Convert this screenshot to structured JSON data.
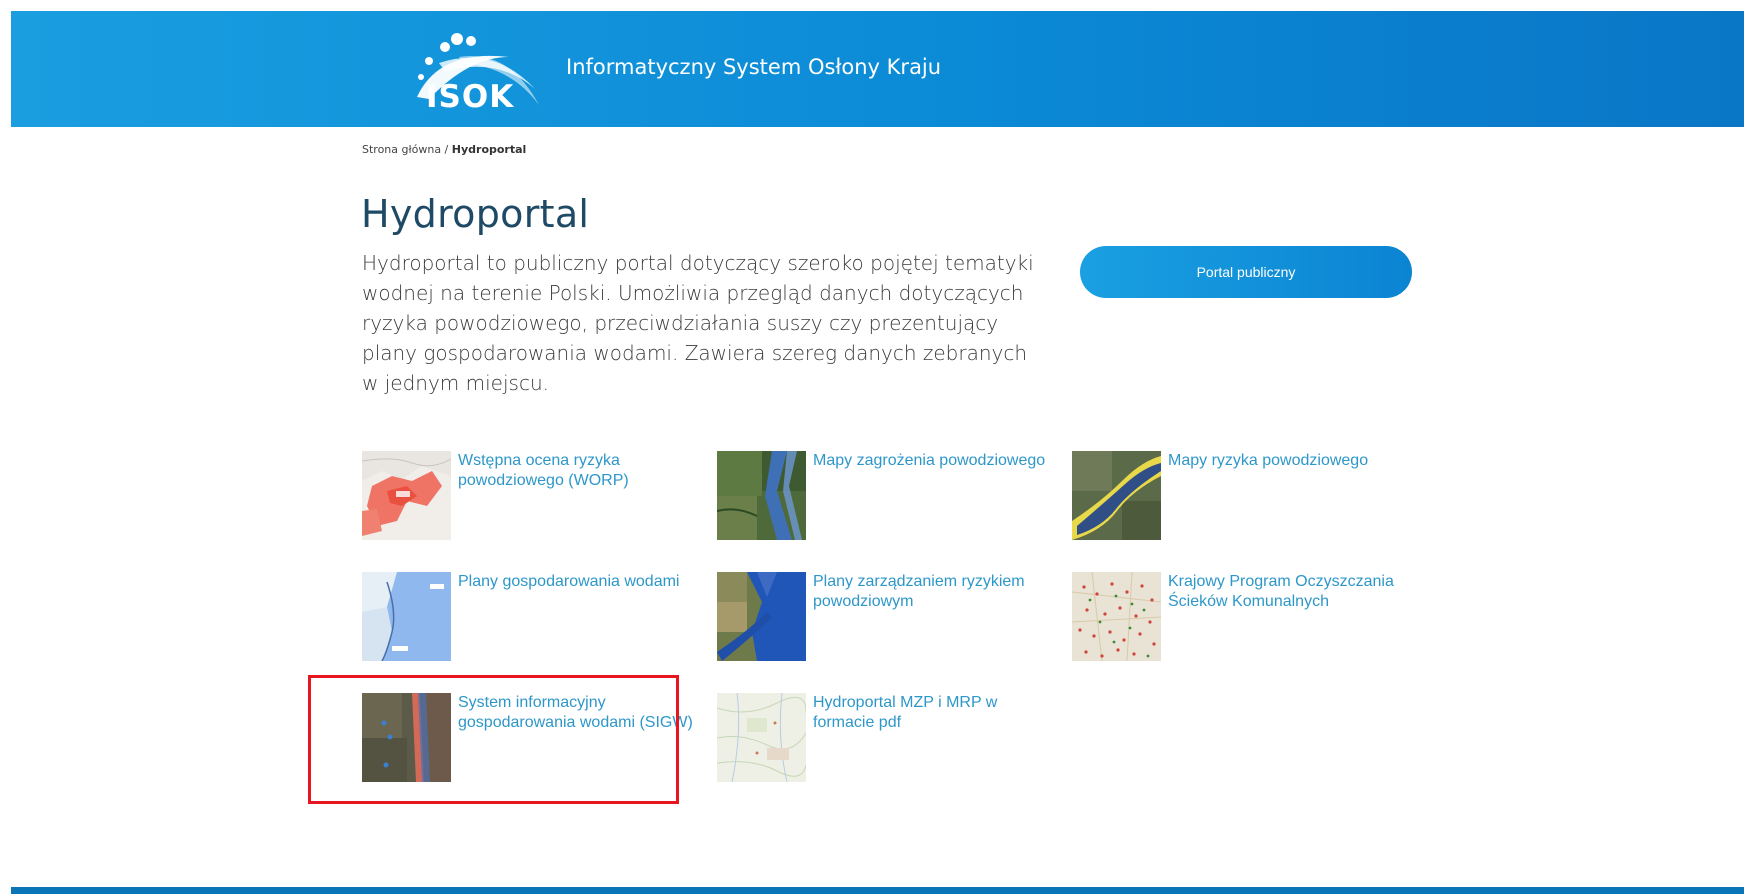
{
  "header": {
    "logo_text": "ISOK",
    "site_title": "Informatyczny System Osłony Kraju"
  },
  "breadcrumb": {
    "home": "Strona główna",
    "separator": " / ",
    "current": "Hydroportal"
  },
  "main": {
    "title": "Hydroportal",
    "description": "Hydroportal to publiczny portal dotyczący szeroko pojętej tematyki wodnej na terenie Polski. Umożliwia przegląd danych dotyczących ryzyka powodziowego, przeciwdziałania suszy czy prezentujący plany gospodarowania wodami. Zawiera szereg danych zebranych w jednym miejscu.",
    "portal_button": "Portal publiczny"
  },
  "tiles": [
    {
      "label": "Wstępna ocena ryzyka powodziowego (WORP)"
    },
    {
      "label": "Mapy zagrożenia powodziowego"
    },
    {
      "label": "Mapy ryzyka powodziowego"
    },
    {
      "label": "Plany gospodarowania wodami"
    },
    {
      "label": "Plany zarządzaniem ryzykiem powodziowym"
    },
    {
      "label": "Krajowy Program Oczyszczania Ścieków Komunalnych"
    },
    {
      "label": "System informacyjny gospodarowania wodami (SIGW)"
    },
    {
      "label": "Hydroportal MZP i MRP w formacie pdf"
    }
  ],
  "colors": {
    "header_blue": "#0b8ad6",
    "link_blue": "#2d97c9",
    "title_navy": "#1f4a66",
    "highlight_red": "#e8141f"
  }
}
